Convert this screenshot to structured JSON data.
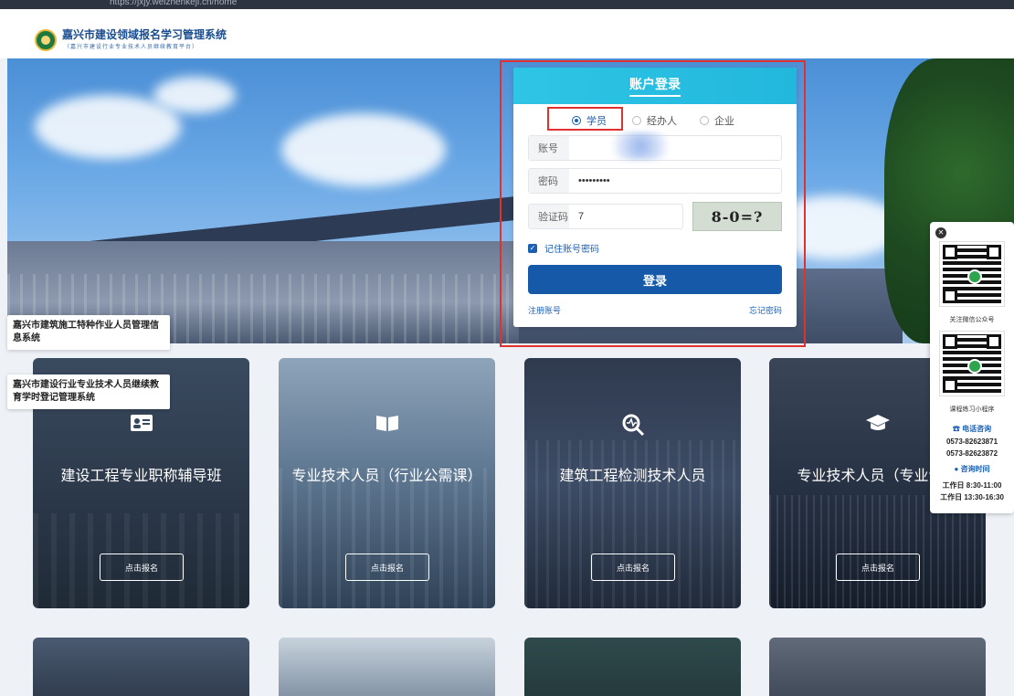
{
  "browser": {
    "url": "https://jxjy.weizhenkeji.cn/home"
  },
  "header": {
    "title": "嘉兴市建设领域报名学习管理系统",
    "subtitle": "（嘉兴市建设行业专业技术人员继续教育平台）"
  },
  "login": {
    "title": "账户登录",
    "roles": [
      "学员",
      "经办人",
      "企业"
    ],
    "selected_role": "学员",
    "account_label": "账号",
    "password_label": "密码",
    "password_value": "•••••••••",
    "captcha_label": "验证码",
    "captcha_value": "7",
    "captcha_image_text": "8-0=?",
    "remember_label": "记住账号密码",
    "submit_label": "登录",
    "register_link": "注册账号",
    "forgot_link": "忘记密码"
  },
  "system_links": [
    {
      "label": "嘉兴市建筑施工特种作业人员管理信息系统"
    },
    {
      "label": "嘉兴市建设行业专业技术人员继续教育学时登记管理系统"
    }
  ],
  "cards": [
    {
      "title": "建设工程专业职称辅导班",
      "button": "点击报名",
      "icon": "id-card-icon"
    },
    {
      "title": "专业技术人员（行业公需课）",
      "button": "点击报名",
      "icon": "book-icon"
    },
    {
      "title": "建筑工程检测技术人员",
      "button": "点击报名",
      "icon": "inspection-icon"
    },
    {
      "title": "专业技术人员（专业课）",
      "button": "点击报名",
      "icon": "graduation-cap-icon"
    }
  ],
  "qr_panel": {
    "qr1_caption": "关注微信公众号",
    "qr2_caption": "课程练习小程序",
    "phone_heading": "电话咨询",
    "phones": [
      "0573-82623871",
      "0573-82623872"
    ],
    "hours_heading": "咨询时间",
    "hours": [
      "工作日 8:30-11:00",
      "工作日 13:30-16:30"
    ]
  },
  "colors": {
    "primary": "#1559a8",
    "login_header": "#2ec5e6",
    "highlight_border": "#e0312f"
  }
}
